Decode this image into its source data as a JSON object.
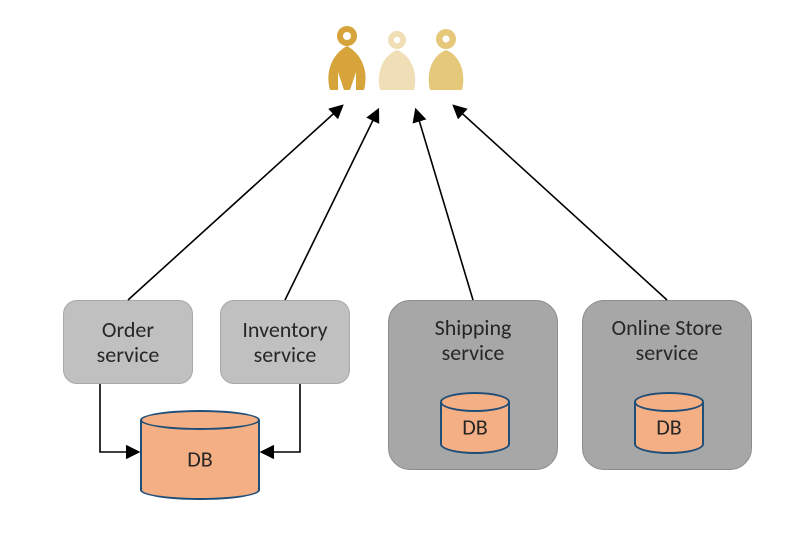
{
  "users_label": "users",
  "services": {
    "order": {
      "label": "Order\nservice"
    },
    "inventory": {
      "label": "Inventory\nservice"
    },
    "shipping": {
      "label": "Shipping\nservice"
    },
    "online_store": {
      "label": "Online Store\nservice"
    }
  },
  "db": {
    "shared": {
      "label": "DB"
    },
    "shipping": {
      "label": "DB"
    },
    "online_store": {
      "label": "DB"
    }
  },
  "colors": {
    "box_small": "#c0c0c0",
    "box_big": "#a7a7a7",
    "db_fill": "#f4b084",
    "db_stroke": "#1f4e79",
    "arrow": "#000000",
    "user1": "#d6a43a",
    "user2": "#f0dfb6",
    "user3": "#e6c87a"
  }
}
